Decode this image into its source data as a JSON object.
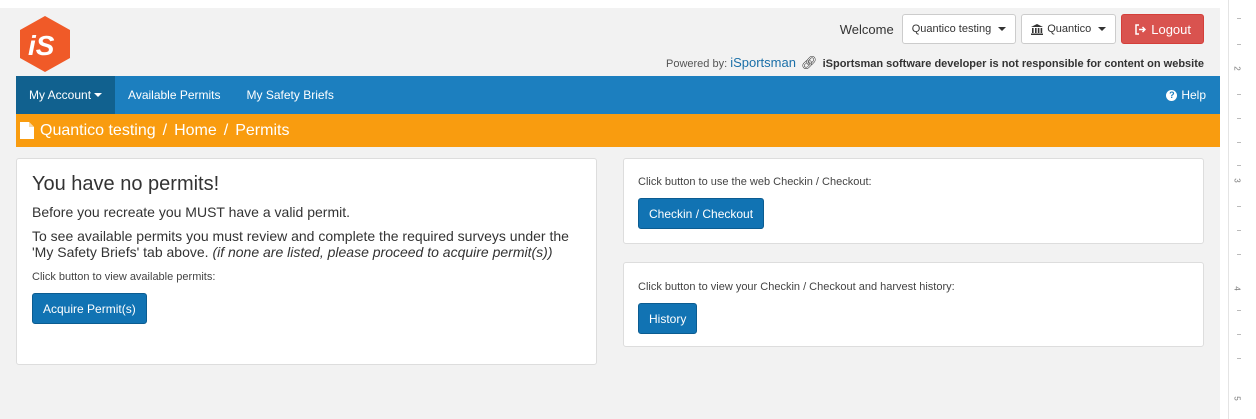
{
  "header": {
    "welcome": "Welcome",
    "user_menu": "Quantico testing",
    "site_menu": "Quantico",
    "logout": "Logout",
    "powered_by": "Powered by:",
    "brand": "iSportsman",
    "disclaimer": "iSportsman software developer is not responsible for content on website"
  },
  "navbar": {
    "items": [
      {
        "label": "My Account"
      },
      {
        "label": "Available Permits"
      },
      {
        "label": "My Safety Briefs"
      }
    ],
    "help": "Help"
  },
  "breadcrumb": [
    "Quantico testing",
    "Home",
    "Permits"
  ],
  "left_panel": {
    "title": "You have no permits!",
    "line1": "Before you recreate you MUST have a valid permit.",
    "line2": "To see available permits you must review and complete the required surveys under the 'My Safety Briefs' tab above.",
    "line2_note": "(if none are listed, please proceed to acquire permit(s))",
    "instruction": "Click button to view available permits:",
    "button": "Acquire Permit(s)"
  },
  "checkin_panel": {
    "instruction": "Click button to use the web Checkin / Checkout:",
    "button": "Checkin / Checkout"
  },
  "history_panel": {
    "instruction": "Click button to view your Checkin / Checkout and harvest history:",
    "button": "History"
  },
  "ruler_labels": [
    "2",
    "3",
    "4",
    "5"
  ],
  "colors": {
    "navbar": "#1c7fbf",
    "navbar_active": "#11618f",
    "breadcrumb": "#f99c0f",
    "logout": "#d9534f",
    "primary_button": "#1173b3",
    "logo": "#f05a28"
  }
}
